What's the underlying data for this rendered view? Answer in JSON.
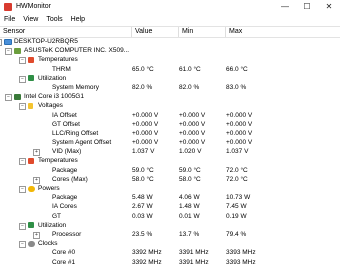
{
  "window": {
    "title": "HWMonitor"
  },
  "menu": [
    "File",
    "View",
    "Tools",
    "Help"
  ],
  "columns": [
    "Sensor",
    "Value",
    "Min",
    "Max"
  ],
  "tree": [
    {
      "label": "DESKTOP-U2RBQR5",
      "level": 0,
      "icon": "computer-icon",
      "expander": "minus"
    },
    {
      "label": "ASUSTeK COMPUTER INC. X509...",
      "level": 1,
      "icon": "motherboard-icon",
      "expander": "minus"
    },
    {
      "label": "Temperatures",
      "level": 2,
      "icon": "thermometer-icon",
      "expander": "minus"
    },
    {
      "label": "THRM",
      "level": 3,
      "value": "65.0 °C",
      "min": "61.0 °C",
      "max": "66.0 °C"
    },
    {
      "label": "Utilization",
      "level": 2,
      "icon": "utilization-icon",
      "expander": "minus"
    },
    {
      "label": "System Memory",
      "level": 3,
      "value": "82.0 %",
      "min": "82.0 %",
      "max": "83.0 %"
    },
    {
      "label": "Intel Core i3 1005G1",
      "level": 1,
      "icon": "cpu-icon",
      "expander": "minus"
    },
    {
      "label": "Voltages",
      "level": 2,
      "icon": "voltage-icon",
      "expander": "minus"
    },
    {
      "label": "IA Offset",
      "level": 3,
      "value": "+0.000 V",
      "min": "+0.000 V",
      "max": "+0.000 V"
    },
    {
      "label": "GT Offset",
      "level": 3,
      "value": "+0.000 V",
      "min": "+0.000 V",
      "max": "+0.000 V"
    },
    {
      "label": "LLC/Ring Offset",
      "level": 3,
      "value": "+0.000 V",
      "min": "+0.000 V",
      "max": "+0.000 V"
    },
    {
      "label": "System Agent Offset",
      "level": 3,
      "value": "+0.000 V",
      "min": "+0.000 V",
      "max": "+0.000 V"
    },
    {
      "label": "VID (Max)",
      "level": 3,
      "expander": "plus",
      "value": "1.037 V",
      "min": "1.020 V",
      "max": "1.037 V"
    },
    {
      "label": "Temperatures",
      "level": 2,
      "icon": "thermometer-icon",
      "expander": "minus"
    },
    {
      "label": "Package",
      "level": 3,
      "value": "59.0 °C",
      "min": "59.0 °C",
      "max": "72.0 °C"
    },
    {
      "label": "Cores (Max)",
      "level": 3,
      "expander": "plus",
      "value": "58.0 °C",
      "min": "58.0 °C",
      "max": "72.0 °C"
    },
    {
      "label": "Powers",
      "level": 2,
      "icon": "power-icon",
      "expander": "minus"
    },
    {
      "label": "Package",
      "level": 3,
      "value": "5.48 W",
      "min": "4.06 W",
      "max": "10.73 W"
    },
    {
      "label": "IA Cores",
      "level": 3,
      "value": "2.67 W",
      "min": "1.48 W",
      "max": "7.45 W"
    },
    {
      "label": "GT",
      "level": 3,
      "value": "0.03 W",
      "min": "0.01 W",
      "max": "0.19 W"
    },
    {
      "label": "Utilization",
      "level": 2,
      "icon": "utilization-icon",
      "expander": "minus"
    },
    {
      "label": "Processor",
      "level": 3,
      "expander": "plus",
      "value": "23.5 %",
      "min": "13.7 %",
      "max": "79.4 %"
    },
    {
      "label": "Clocks",
      "level": 2,
      "icon": "clock-icon",
      "expander": "minus"
    },
    {
      "label": "Core #0",
      "level": 3,
      "value": "3392 MHz",
      "min": "3391 MHz",
      "max": "3393 MHz"
    },
    {
      "label": "Core #1",
      "level": 3,
      "value": "3392 MHz",
      "min": "3391 MHz",
      "max": "3393 MHz"
    }
  ]
}
